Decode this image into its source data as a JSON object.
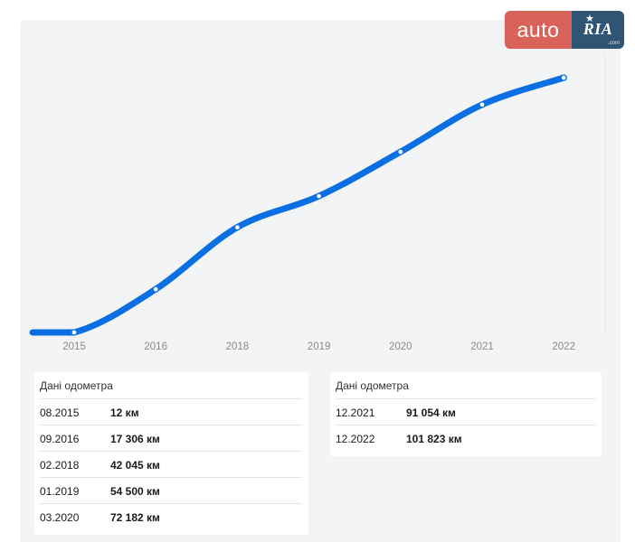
{
  "brand": {
    "auto": "auto",
    "ria": "RIA",
    "ria_sub": ".com"
  },
  "chart_data": {
    "type": "line",
    "x": [
      "2015",
      "2016",
      "2018",
      "2019",
      "2020",
      "2021",
      "2022"
    ],
    "values": [
      12,
      17306,
      42045,
      54500,
      72182,
      91054,
      101823
    ],
    "ylim": [
      0,
      101823
    ],
    "grid": false,
    "colors": {
      "line": "#0a6fe3",
      "point_fill": "#ffffff"
    }
  },
  "tables": [
    {
      "title": "Дані одометра",
      "rows": [
        {
          "date": "08.2015",
          "km": "12 км"
        },
        {
          "date": "09.2016",
          "km": "17 306 км"
        },
        {
          "date": "02.2018",
          "km": "42 045 км"
        },
        {
          "date": "01.2019",
          "km": "54 500 км"
        },
        {
          "date": "03.2020",
          "km": "72 182 км"
        }
      ]
    },
    {
      "title": "Дані одометра",
      "rows": [
        {
          "date": "12.2021",
          "km": "91 054 км"
        },
        {
          "date": "12.2022",
          "km": "101 823 км"
        }
      ]
    }
  ]
}
